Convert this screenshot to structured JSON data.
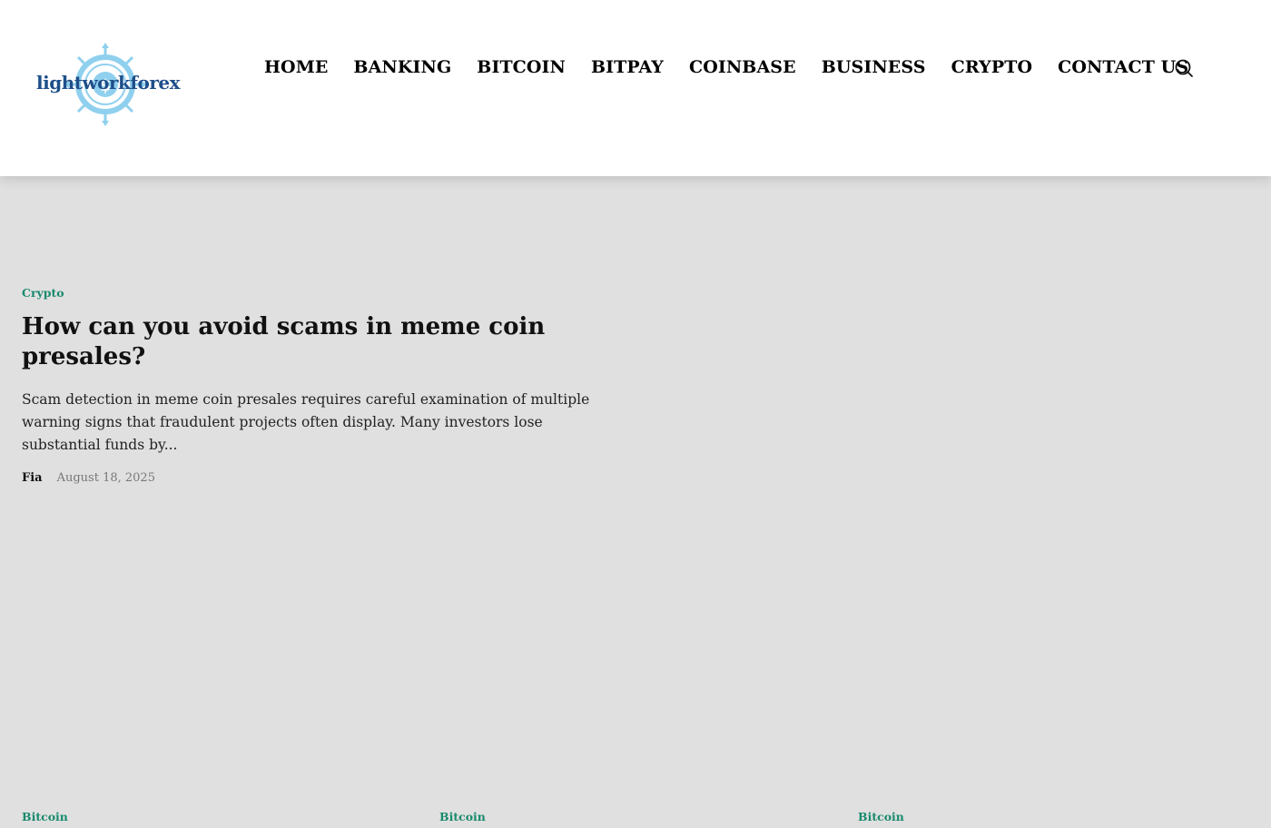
{
  "brand": {
    "logo_text": "lightworkforex"
  },
  "nav": {
    "items": [
      "HOME",
      "BANKING",
      "BITCOIN",
      "BITPAY",
      "COINBASE",
      "BUSINESS",
      "CRYPTO",
      "CONTACT US"
    ]
  },
  "search": {
    "icon": "search-icon"
  },
  "featured_post": {
    "category": "Crypto",
    "title": "How can you avoid scams in meme coin presales?",
    "excerpt": "Scam detection in meme coin presales requires careful examination of multiple warning signs that fraudulent projects often display. Many investors lose substantial funds by...",
    "author": "Fia",
    "date": "August 18, 2025"
  },
  "bottom_categories": [
    "Bitcoin",
    "Bitcoin",
    "Bitcoin"
  ],
  "colors": {
    "category": "#1a8a6e",
    "logo_text": "#1e4f8a",
    "logo_emblem": "#8fd0ee",
    "background": "#e0e0e0",
    "header": "#ffffff"
  }
}
